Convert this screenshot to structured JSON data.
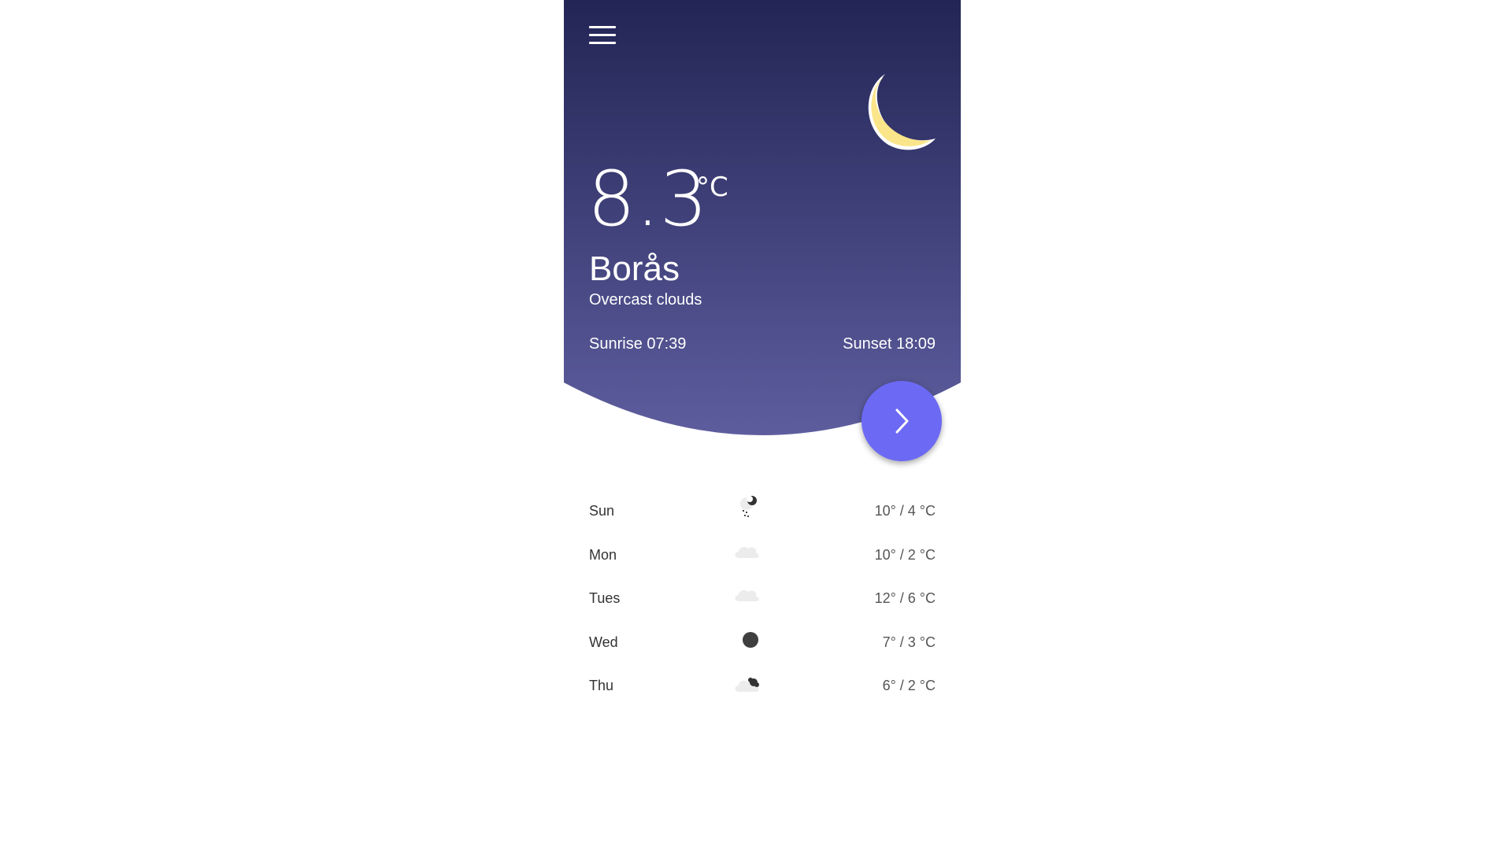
{
  "menu": {
    "icon": "hamburger-menu-icon"
  },
  "current": {
    "temperature": "8.3",
    "unit": "°C",
    "city": "Borås",
    "condition": "Overcast clouds",
    "sunrise": "Sunrise 07:39",
    "sunset": "Sunset 18:09",
    "icon": "crescent-moon-icon"
  },
  "next_button": {
    "icon": "chevron-right-icon"
  },
  "colors": {
    "gradient_top": "#232555",
    "gradient_bottom": "#5d5d9e",
    "moon": "#fbe58a",
    "accent": "#6c6af4"
  },
  "forecast": [
    {
      "day": "Sun",
      "range": "10° / 4 °C",
      "icon": "rain-night-icon"
    },
    {
      "day": "Mon",
      "range": "10° / 2 °C",
      "icon": "cloud-icon"
    },
    {
      "day": "Tues",
      "range": "12° / 6 °C",
      "icon": "cloud-icon"
    },
    {
      "day": "Wed",
      "range": "7° / 3 °C",
      "icon": "moon-icon"
    },
    {
      "day": "Thu",
      "range": "6° / 2 °C",
      "icon": "cloud-moon-icon"
    }
  ]
}
